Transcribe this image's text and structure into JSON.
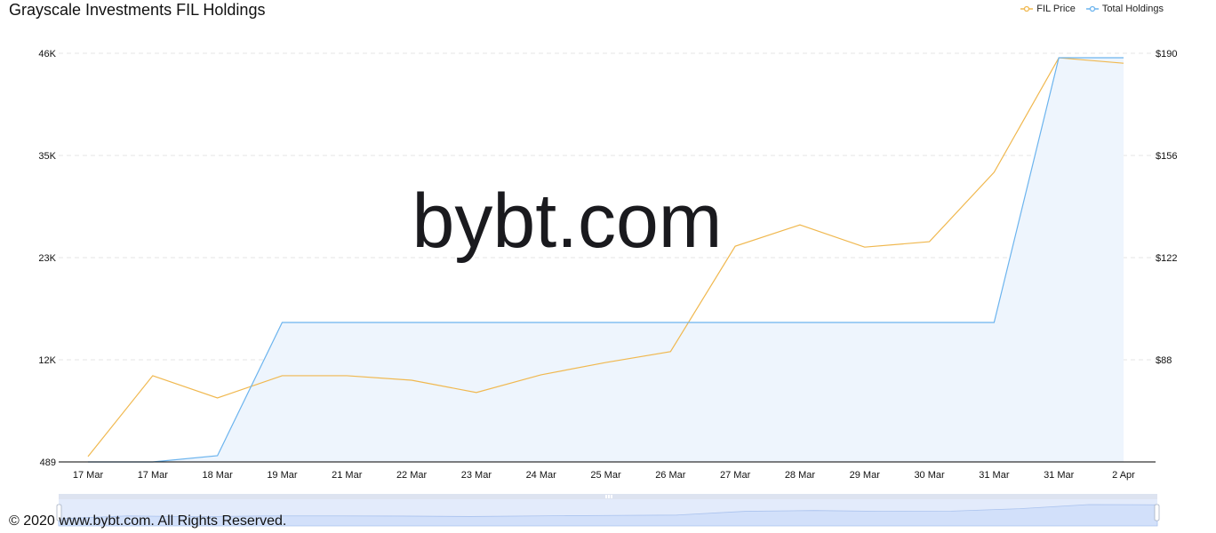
{
  "title": "Grayscale Investments FIL Holdings",
  "watermark": "bybt.com",
  "footer": "© 2020 www.bybt.com. All Rights Reserved.",
  "legend": [
    {
      "label": "FIL Price",
      "color": "#f0b84f"
    },
    {
      "label": "Total Holdings",
      "color": "#6cb4ee"
    }
  ],
  "colors": {
    "price": "#f0b84f",
    "holdings": "#6cb4ee",
    "holdings_fill": "#eef5fd",
    "grid": "#e6e6e6",
    "slider_bg": "#e3ebfb",
    "slider_fill": "#d2e0fa",
    "slider_top": "#dde3f0"
  },
  "chart_data": {
    "type": "line",
    "title": "Grayscale Investments FIL Holdings",
    "categories": [
      "17 Mar",
      "17 Mar",
      "18 Mar",
      "19 Mar",
      "21 Mar",
      "22 Mar",
      "23 Mar",
      "24 Mar",
      "25 Mar",
      "26 Mar",
      "27 Mar",
      "28 Mar",
      "29 Mar",
      "30 Mar",
      "31 Mar",
      "31 Mar",
      "2 Apr"
    ],
    "series": [
      {
        "name": "FIL Price",
        "axis": "right",
        "values": [
          55.8,
          82.7,
          75.3,
          82.7,
          82.7,
          81.2,
          77.1,
          83.0,
          87.1,
          90.7,
          125.8,
          132.9,
          125.5,
          127.3,
          150.4,
          188.5,
          186.7
        ]
      },
      {
        "name": "Total Holdings",
        "axis": "left",
        "area": true,
        "values": [
          489,
          489,
          1182,
          16022,
          16022,
          16022,
          16022,
          16022,
          16022,
          16022,
          16022,
          16022,
          16022,
          16022,
          16022,
          45505,
          45505
        ]
      }
    ],
    "y_left": {
      "ticks": [
        "489",
        "12K",
        "23K",
        "35K",
        "46K"
      ],
      "range": [
        489,
        46000
      ]
    },
    "y_right": {
      "ticks": [
        "$88",
        "$122",
        "$156",
        "$190"
      ],
      "tick_values": [
        88,
        122,
        156,
        190
      ],
      "range": [
        54,
        190
      ]
    },
    "grid": true,
    "legend_position": "top-right",
    "xlabel": "",
    "ylabel": ""
  }
}
